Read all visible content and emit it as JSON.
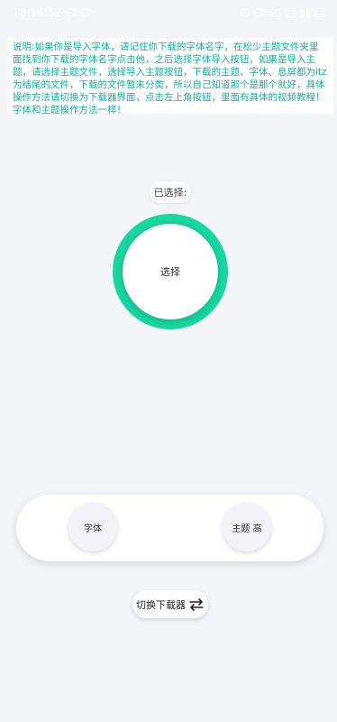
{
  "status_bar": {
    "time": "16:14:52",
    "network": "5G",
    "icons": [
      "location-icon",
      "settings-icon",
      "alarm-icon",
      "wifi-icon",
      "sim-icon",
      "signal-icon",
      "battery-icon"
    ]
  },
  "notice": {
    "text": "说明:如果你是导入字体，请记住你下载的字体名字，在松少主题文件夹里面找到你下载的字体名字点击他，之后选择字体导入按钮，如果是导入主题，请选择主题文件，选择导入主题按钮，下载的主题、字体、息屏都为itz为结尾的文件，下载的文件暂未分类，所以自己知道那个是那个就好，具体操作方法请切换为下载器界面，点击左上角按钮，里面有具体的视频教程！字体和主题操作方法一样！",
    "color": "#0fb39a"
  },
  "selection": {
    "selected_label": "已选择:",
    "select_label": "选择",
    "ring_color": "#16d7a0"
  },
  "bottom_bar": {
    "font_label": "字体",
    "theme_label": "主题 高"
  },
  "switch_button": {
    "label": "切换下载器",
    "icon": "swap-arrows-icon"
  }
}
